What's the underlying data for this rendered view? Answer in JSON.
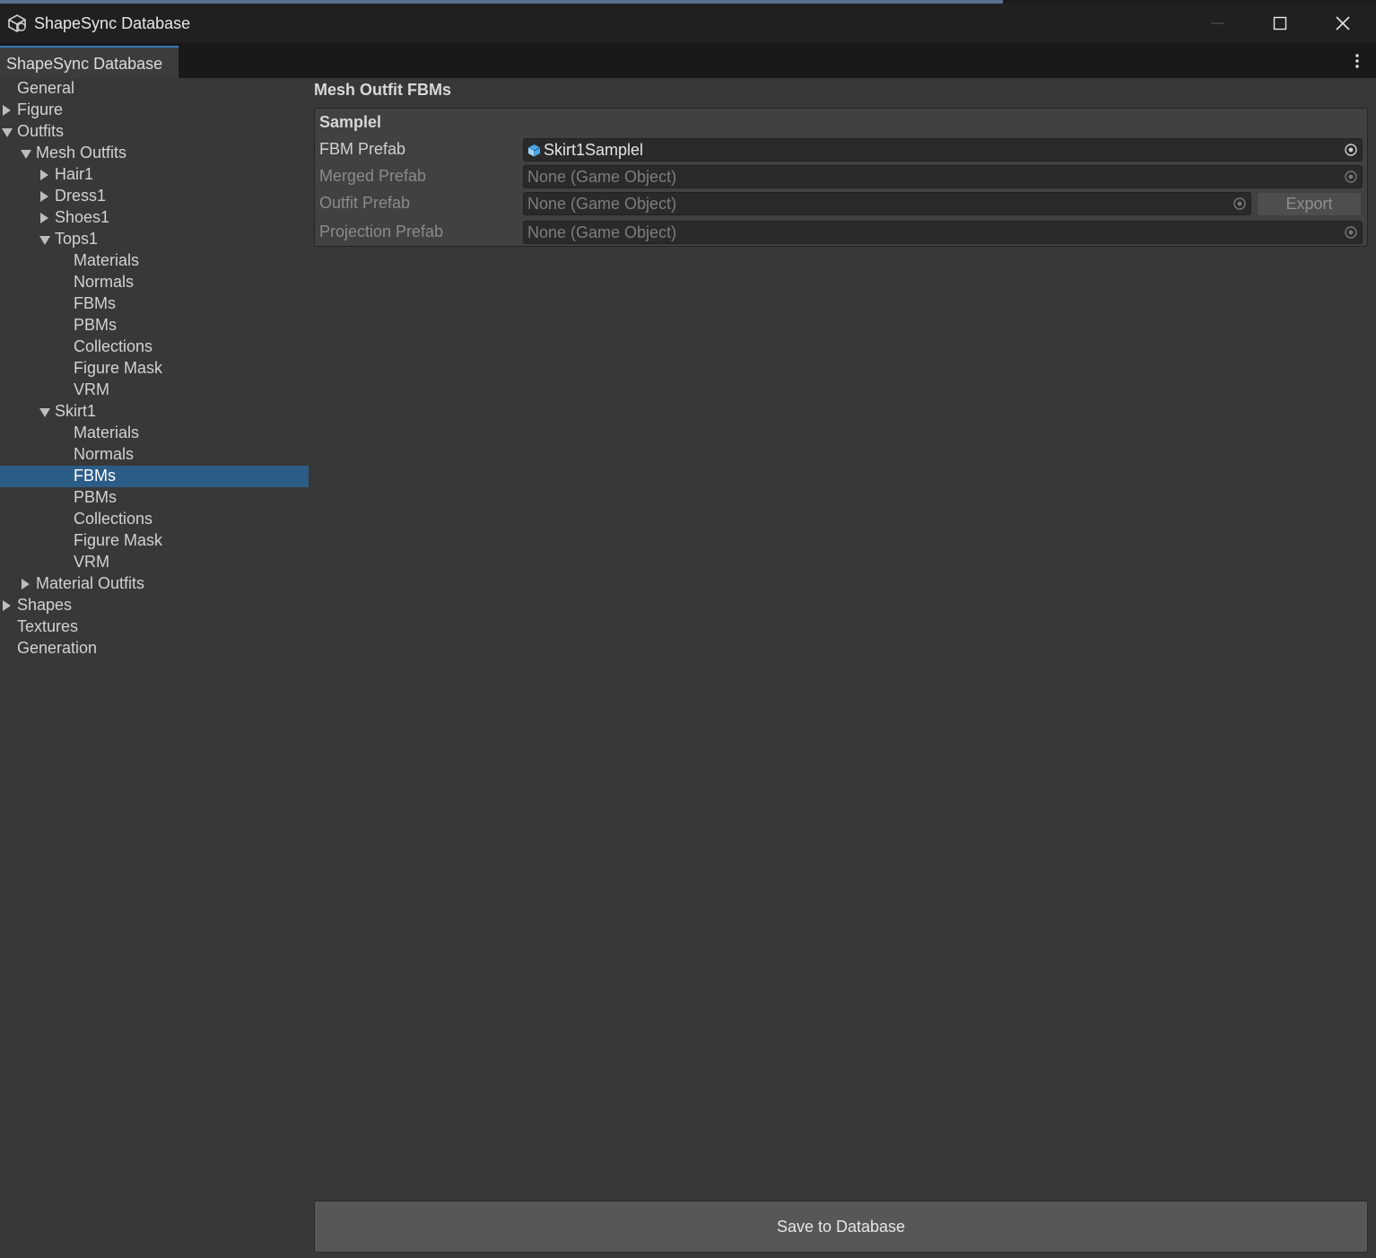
{
  "window": {
    "title": "ShapeSync Database",
    "tab_label": "ShapeSync Database"
  },
  "sidebar": {
    "items": [
      {
        "label": "General",
        "expand": "none"
      },
      {
        "label": "Figure",
        "expand": "collapsed"
      },
      {
        "label": "Outfits",
        "expand": "expanded"
      },
      {
        "label": "Mesh Outfits",
        "expand": "expanded"
      },
      {
        "label": "Hair1",
        "expand": "collapsed"
      },
      {
        "label": "Dress1",
        "expand": "collapsed"
      },
      {
        "label": "Shoes1",
        "expand": "collapsed"
      },
      {
        "label": "Tops1",
        "expand": "expanded"
      },
      {
        "label": "Materials",
        "expand": "none"
      },
      {
        "label": "Normals",
        "expand": "none"
      },
      {
        "label": "FBMs",
        "expand": "none"
      },
      {
        "label": "PBMs",
        "expand": "none"
      },
      {
        "label": "Collections",
        "expand": "none"
      },
      {
        "label": "Figure Mask",
        "expand": "none"
      },
      {
        "label": "VRM",
        "expand": "none"
      },
      {
        "label": "Skirt1",
        "expand": "expanded"
      },
      {
        "label": "Materials",
        "expand": "none"
      },
      {
        "label": "Normals",
        "expand": "none"
      },
      {
        "label": "FBMs",
        "expand": "none",
        "selected": true
      },
      {
        "label": "PBMs",
        "expand": "none"
      },
      {
        "label": "Collections",
        "expand": "none"
      },
      {
        "label": "Figure Mask",
        "expand": "none"
      },
      {
        "label": "VRM",
        "expand": "none"
      },
      {
        "label": "Material Outfits",
        "expand": "collapsed"
      },
      {
        "label": "Shapes",
        "expand": "collapsed"
      },
      {
        "label": "Textures",
        "expand": "none"
      },
      {
        "label": "Generation",
        "expand": "none"
      }
    ]
  },
  "main": {
    "section_title": "Mesh Outfit FBMs",
    "card": {
      "title": "Samplel",
      "fbm_prefab_label": "FBM Prefab",
      "fbm_prefab_value": "Skirt1Samplel",
      "merged_prefab_label": "Merged Prefab",
      "merged_prefab_value": "None (Game Object)",
      "outfit_prefab_label": "Outfit Prefab",
      "outfit_prefab_value": "None (Game Object)",
      "export_label": "Export",
      "projection_prefab_label": "Projection Prefab",
      "projection_prefab_value": "None (Game Object)"
    },
    "save_label": "Save to Database"
  },
  "colors": {
    "background": "#383838",
    "selection": "#2c5d87",
    "tab_accent": "#3a79bb"
  }
}
